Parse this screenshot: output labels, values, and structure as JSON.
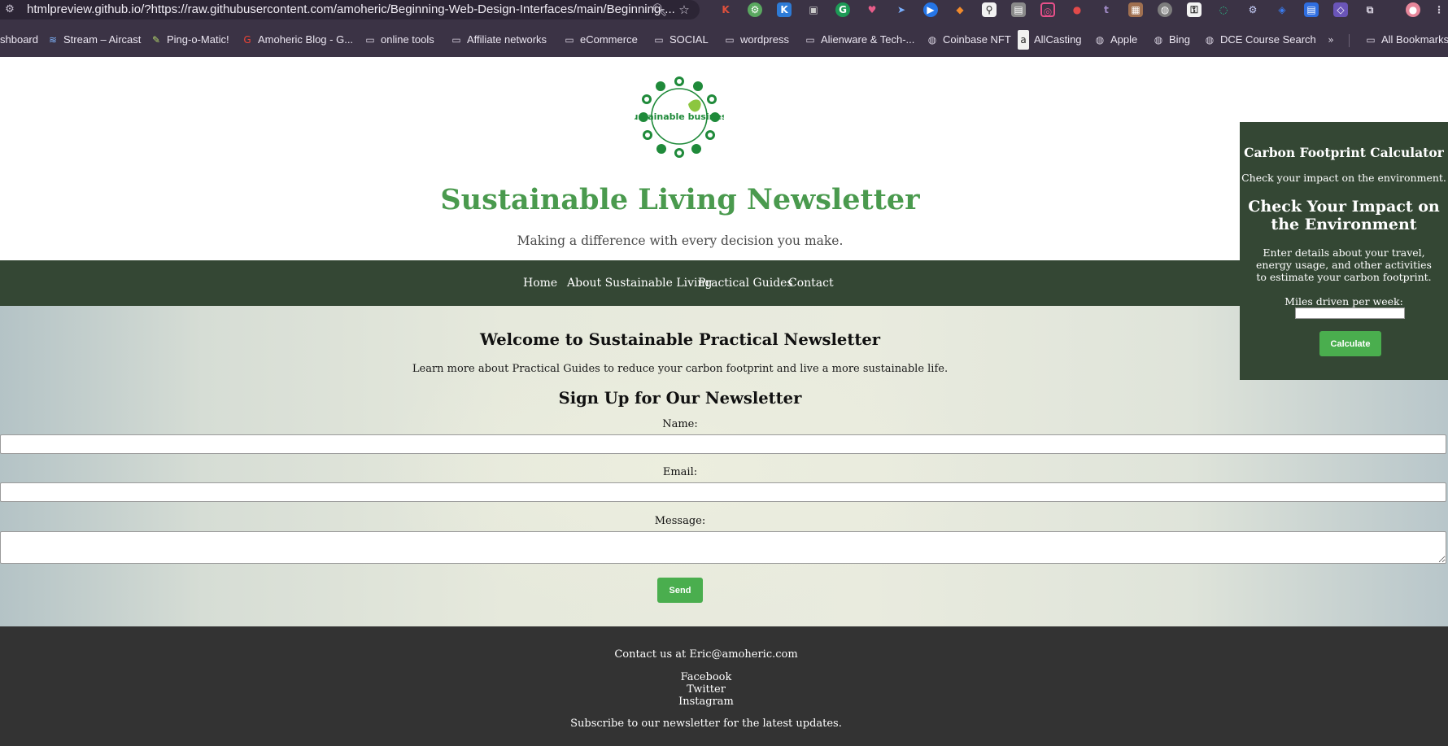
{
  "browser": {
    "url": "htmlpreview.github.io/?https://raw.githubusercontent.com/amoheric/Beginning-Web-Design-Interfaces/main/Beginning-...",
    "bookmarks": [
      {
        "label": "shboard",
        "icon": "page-icon"
      },
      {
        "label": "Stream – Aircast",
        "icon": "aircast-icon"
      },
      {
        "label": "Ping-o-Matic!",
        "icon": "ping-icon"
      },
      {
        "label": "Amoheric Blog - G...",
        "icon": "google-icon"
      },
      {
        "label": "online tools",
        "icon": "folder-icon"
      },
      {
        "label": "Affiliate networks",
        "icon": "folder-icon"
      },
      {
        "label": "eCommerce",
        "icon": "folder-icon"
      },
      {
        "label": "SOCIAL",
        "icon": "folder-icon"
      },
      {
        "label": "wordpress",
        "icon": "folder-icon"
      },
      {
        "label": "Alienware & Tech-...",
        "icon": "folder-icon"
      },
      {
        "label": "Coinbase NFT",
        "icon": "globe-icon"
      },
      {
        "label": "AllCasting",
        "icon": "allcasting-icon"
      },
      {
        "label": "Apple",
        "icon": "globe-icon"
      },
      {
        "label": "Bing",
        "icon": "globe-icon"
      },
      {
        "label": "DCE Course Search",
        "icon": "globe-icon"
      },
      {
        "label": "All Bookmarks",
        "icon": "folder-icon"
      }
    ]
  },
  "header": {
    "logo_text": "sustainable business",
    "title": "Sustainable Living Newsletter",
    "tagline": "Making a difference with every decision you make."
  },
  "nav": {
    "items": [
      "Home",
      "About Sustainable Living",
      "Practical Guides",
      "Contact"
    ]
  },
  "main": {
    "welcome_heading": "Welcome to Sustainable Practical Newsletter",
    "intro": "Learn more about Practical Guides to reduce your carbon footprint and live a more sustainable life.",
    "signup_heading": "Sign Up for Our Newsletter",
    "form": {
      "name_label": "Name:",
      "email_label": "Email:",
      "message_label": "Message:",
      "submit_label": "Send"
    }
  },
  "footer": {
    "contact": "Contact us at Eric@amoheric.com",
    "links": [
      "Facebook",
      "Twitter",
      "Instagram"
    ],
    "subscribe": "Subscribe to our newsletter for the latest updates."
  },
  "calculator": {
    "title": "Carbon Footprint Calculator",
    "subtitle": "Check your impact on the environment.",
    "heading": "Check Your Impact on the Environment",
    "description": "Enter details about your travel, energy usage, and other activities to estimate your carbon footprint.",
    "miles_label": "Miles driven per week:",
    "button_label": "Calculate"
  },
  "colors": {
    "nav_bg": "#344734",
    "title_green": "#4a9a4e",
    "button_green": "#4aae4e",
    "footer_bg": "#333333",
    "chrome_bg": "#3b3345"
  }
}
